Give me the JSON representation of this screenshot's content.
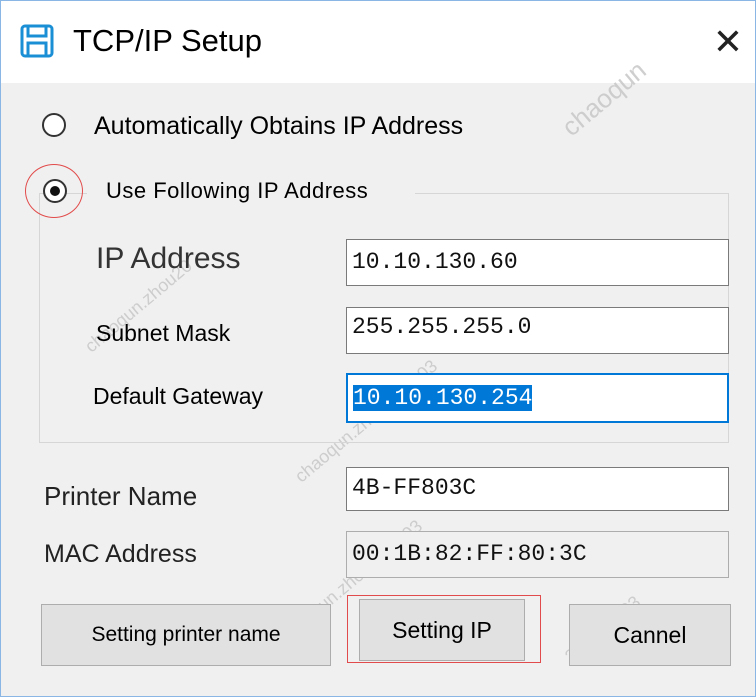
{
  "window": {
    "title": "TCP/IP Setup",
    "close_glyph": "✕"
  },
  "ip_mode": {
    "auto_label": "Automatically Obtains IP Address",
    "manual_label": "Use Following IP Address",
    "selected": "manual"
  },
  "network": {
    "ip_address_label": "IP Address",
    "ip_address_value": "10.10.130.60",
    "subnet_mask_label": "Subnet Mask",
    "subnet_mask_value": "255.255.255.0",
    "default_gateway_label": "Default Gateway",
    "default_gateway_value": "10.10.130.254"
  },
  "printer": {
    "name_label": "Printer Name",
    "name_value": "4B-FF803C",
    "mac_label": "MAC Address",
    "mac_value": "00:1B:82:FF:80:3C"
  },
  "buttons": {
    "set_name": "Setting printer name",
    "set_ip": "Setting IP",
    "cancel": "Cannel"
  },
  "watermarks": [
    "chaoqun",
    "chaoqun.zhou20",
    "chaoqun.zhou2022-03",
    "chaoqun.zhou2022-03",
    "2022-03-03"
  ],
  "colors": {
    "accent": "#0078d7",
    "annotation": "#e24b4b",
    "icon": "#1a8fd6"
  },
  "icons": {
    "title": "save-disk-icon"
  }
}
